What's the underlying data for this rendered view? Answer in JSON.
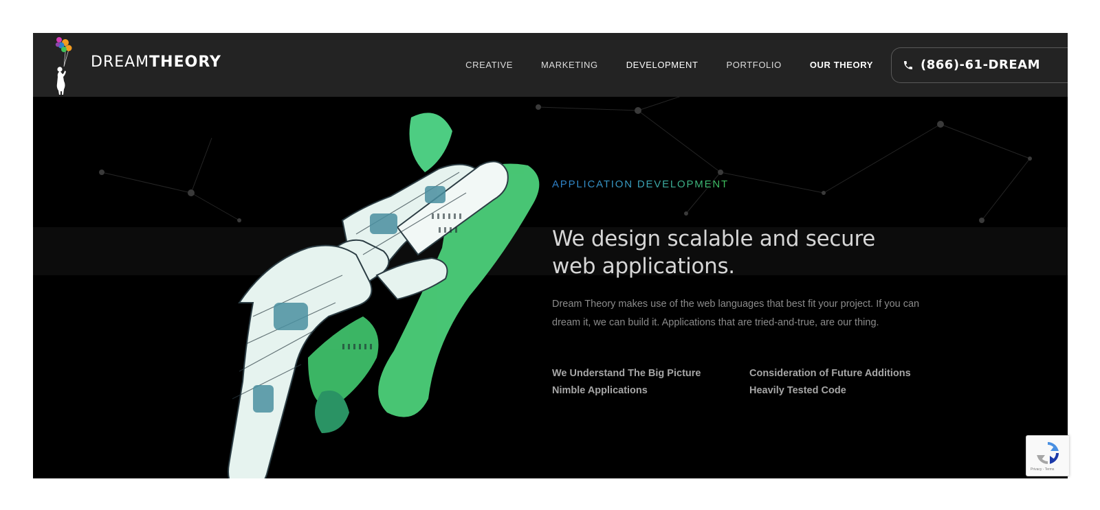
{
  "brand": {
    "name_light": "DREAM",
    "name_bold": "THEORY"
  },
  "nav": {
    "items": [
      {
        "label": "CREATIVE"
      },
      {
        "label": "MARKETING"
      },
      {
        "label": "DEVELOPMENT"
      },
      {
        "label": "PORTFOLIO"
      },
      {
        "label": "OUR THEORY"
      }
    ],
    "active": "OUR THEORY",
    "phone": "(866)-61-DREAM"
  },
  "hero": {
    "eyebrow": "APPLICATION DEVELOPMENT",
    "headline": "We design scalable and secure web applications.",
    "description": "Dream Theory makes use of the web languages that best fit your project. If you can dream it, we can build it. Applications that are tried-and-true, are our thing.",
    "features": [
      "We Understand The Big Picture",
      "Consideration of Future Additions",
      "Nimble Applications",
      "Heavily Tested Code"
    ]
  },
  "recaptcha": {
    "text": "Privacy - Terms"
  },
  "colors": {
    "topbar": "#232323",
    "hero_bg": "#000000",
    "eyebrow_start": "#2d7fc9",
    "eyebrow_end": "#3fc259",
    "accent_green": "#3fc259",
    "headline": "#d6d6d6",
    "body_text": "#8b8b8b"
  },
  "icons": {
    "logo": "girl-with-balloons-icon",
    "phone": "phone-icon",
    "recaptcha": "recaptcha-icon"
  }
}
